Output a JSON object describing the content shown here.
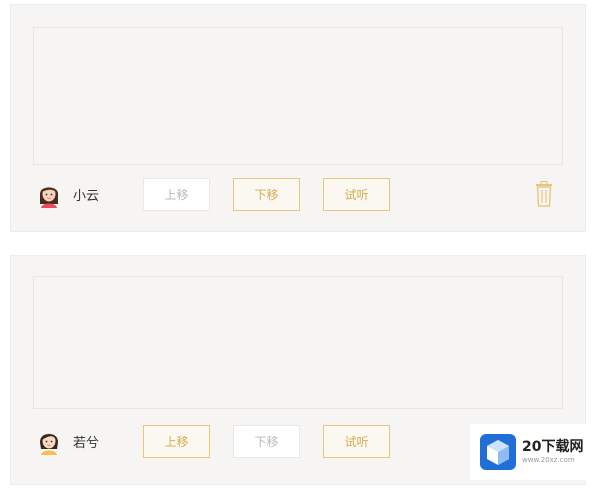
{
  "entries": [
    {
      "speaker_name": "小云",
      "text": "",
      "buttons": {
        "move_up": "上移",
        "move_down": "下移",
        "preview": "试听"
      },
      "active": {
        "move_up": false,
        "move_down": true,
        "preview": true
      }
    },
    {
      "speaker_name": "若兮",
      "text": "",
      "buttons": {
        "move_up": "上移",
        "move_down": "下移",
        "preview": "试听"
      },
      "active": {
        "move_up": true,
        "move_down": false,
        "preview": true
      }
    }
  ],
  "watermark": {
    "brand": "20下载网",
    "domain": "www.20xz.com"
  },
  "colors": {
    "accent_gold": "#d6aa50",
    "card_bg": "#f6f5f3"
  },
  "icons": {
    "delete": "trash-icon",
    "avatar": "avatar-icon"
  }
}
